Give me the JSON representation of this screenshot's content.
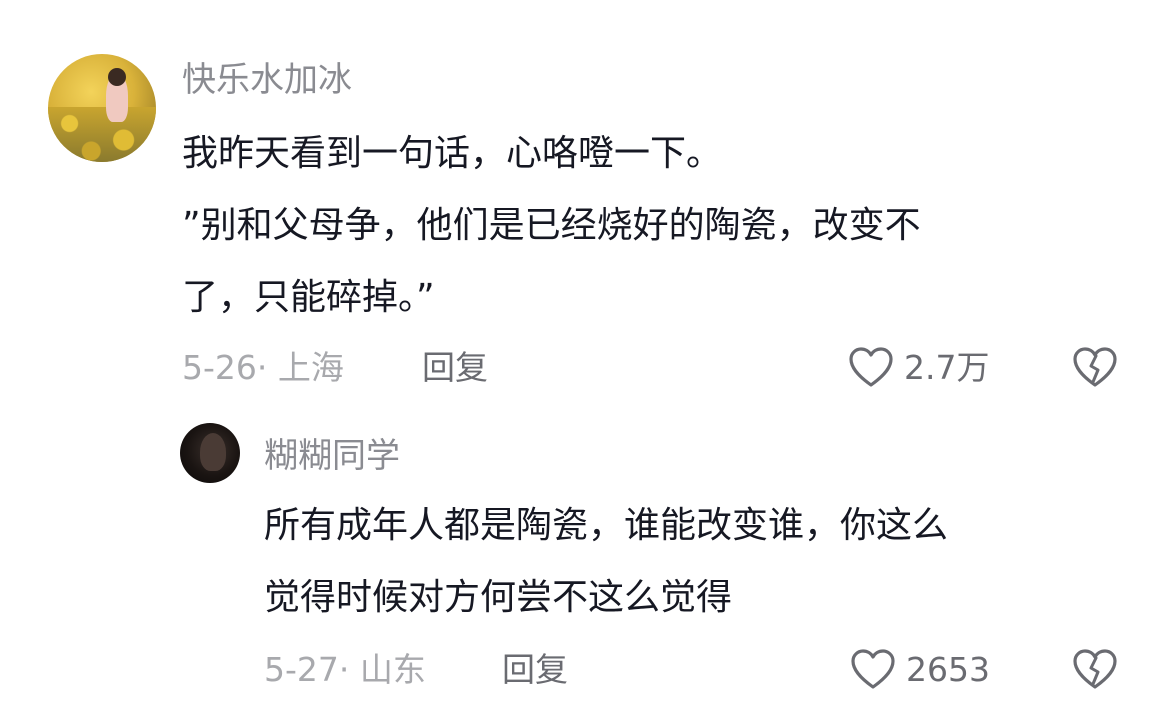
{
  "comment": {
    "username": "快乐水加冰",
    "lines": [
      "我昨天看到一句话，心咯噔一下。",
      "”别和父母争，他们是已经烧好的陶瓷，改变不",
      "了，只能碎掉。”"
    ],
    "date_location": "5-26· 上海",
    "reply_label": "回复",
    "like_count": "2.7万",
    "icons": {
      "like": "heart-outline-icon",
      "dislike": "broken-heart-icon"
    }
  },
  "reply": {
    "username": "糊糊同学",
    "lines": [
      "所有成年人都是陶瓷，谁能改变谁，你这么",
      "觉得时候对方何尝不这么觉得"
    ],
    "date_location": "5-27· 山东",
    "reply_label": "回复",
    "like_count": "2653",
    "icons": {
      "like": "heart-outline-icon",
      "dislike": "broken-heart-icon"
    }
  },
  "colors": {
    "username": "#8a8b91",
    "content": "#161823",
    "meta": "#a8a9ad",
    "action": "#6a6b71"
  }
}
